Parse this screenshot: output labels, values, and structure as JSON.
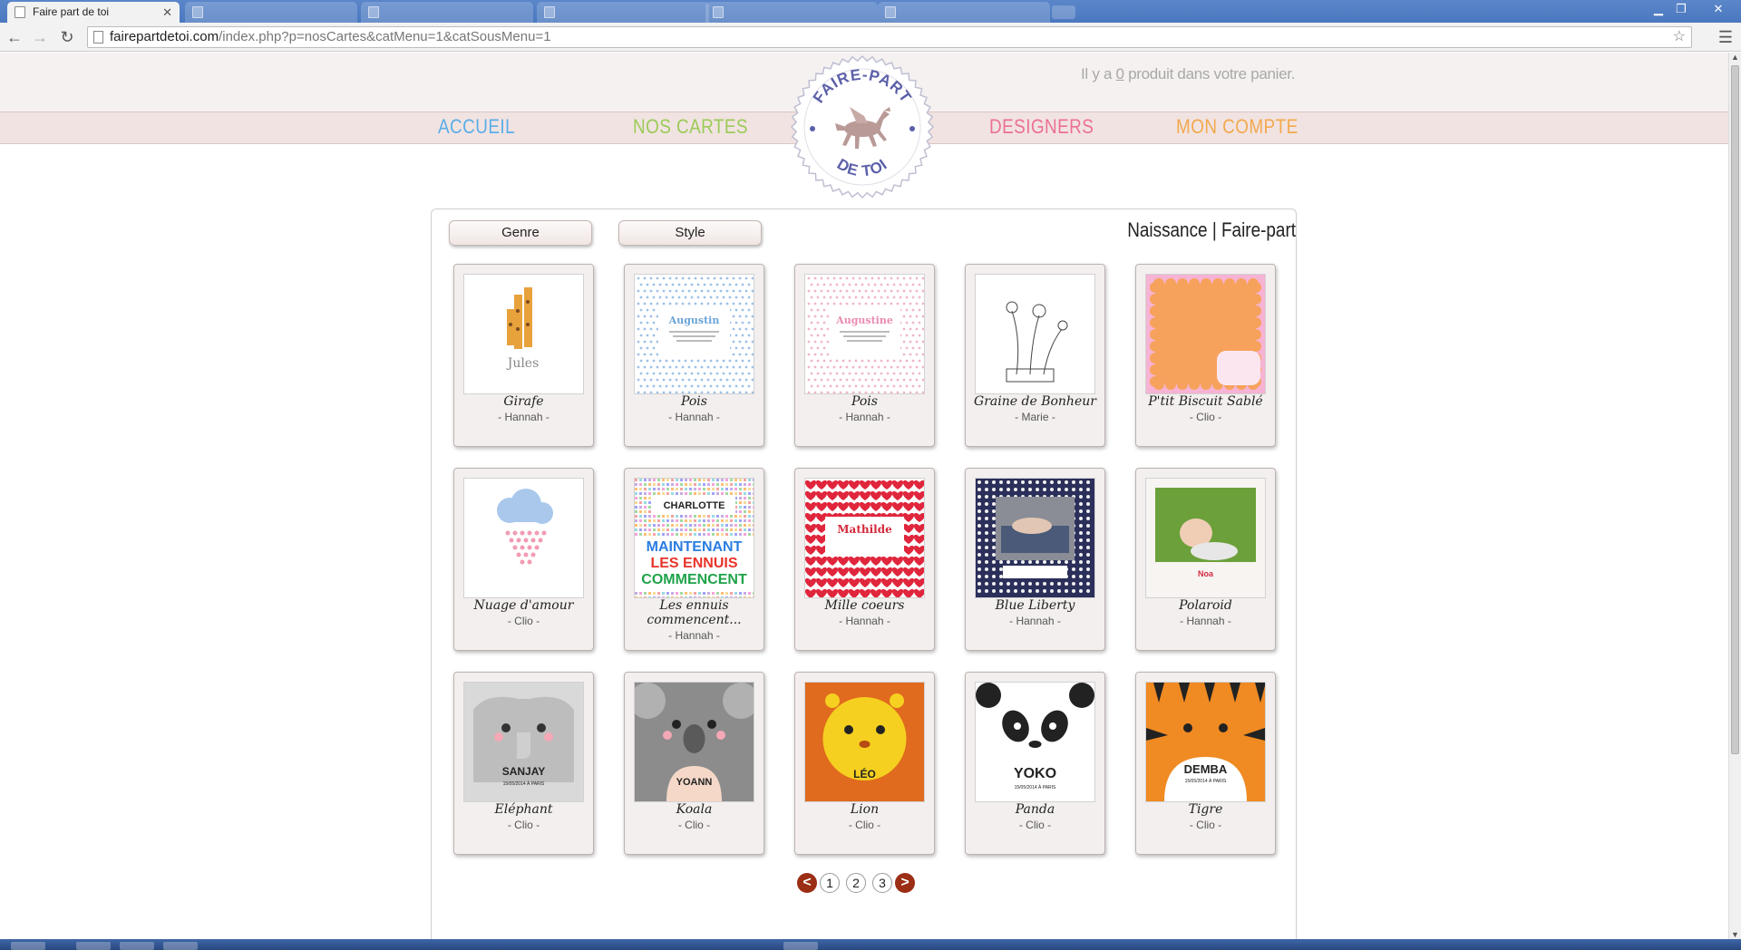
{
  "browser": {
    "active_tab_title": "Faire part de toi",
    "url_host": "fairepartdetoi.com",
    "url_path": "/index.php?p=nosCartes&catMenu=1&catSousMenu=1"
  },
  "header": {
    "cart_prefix": "Il y a ",
    "cart_count": "0",
    "cart_suffix": " produit dans votre panier.",
    "logo_top": "FAIRE-PART",
    "logo_bottom": "DE TOI"
  },
  "nav": [
    {
      "label": "ACCUEIL",
      "color": "#5aaee8"
    },
    {
      "label": "NOS CARTES",
      "color": "#9bcb58"
    },
    {
      "label": "DESIGNERS",
      "color": "#ec7094"
    },
    {
      "label": "MON COMPTE",
      "color": "#f2a94f"
    }
  ],
  "filters": {
    "genre": "Genre",
    "style": "Style"
  },
  "section_title": "Naissance | Faire-part",
  "cards": [
    {
      "name": "Girafe",
      "designer": "- Hannah -",
      "art": "girafe"
    },
    {
      "name": "Pois",
      "designer": "- Hannah -",
      "art": "pois-blue",
      "thumb_text": "Augustin"
    },
    {
      "name": "Pois",
      "designer": "- Hannah -",
      "art": "pois-pink",
      "thumb_text": "Augustine"
    },
    {
      "name": "Graine de Bonheur",
      "designer": "- Marie -",
      "art": "graine"
    },
    {
      "name": "P'tit Biscuit Sablé",
      "designer": "- Clio -",
      "art": "biscuit"
    },
    {
      "name": "Nuage d'amour",
      "designer": "- Clio -",
      "art": "nuage"
    },
    {
      "name": "Les ennuis commencent...",
      "designer": "- Hannah -",
      "art": "ennuis",
      "thumb_text": "CHARLOTTE",
      "thumb_lines": [
        "MAINTENANT",
        "LES ENNUIS",
        "COMMENCENT"
      ]
    },
    {
      "name": "Mille coeurs",
      "designer": "- Hannah -",
      "art": "coeurs",
      "thumb_text": "Mathilde"
    },
    {
      "name": "Blue Liberty",
      "designer": "- Hannah -",
      "art": "liberty"
    },
    {
      "name": "Polaroid",
      "designer": "- Hannah -",
      "art": "polaroid",
      "thumb_text": "Noa"
    },
    {
      "name": "Eléphant",
      "designer": "- Clio -",
      "art": "elephant",
      "thumb_text": "SANJAY",
      "thumb_sub": "15/05/2014 À PARIS"
    },
    {
      "name": "Koala",
      "designer": "- Clio -",
      "art": "koala",
      "thumb_text": "YOANN"
    },
    {
      "name": "Lion",
      "designer": "- Clio -",
      "art": "lion",
      "thumb_text": "LÉO"
    },
    {
      "name": "Panda",
      "designer": "- Clio -",
      "art": "panda",
      "thumb_text": "YOKO",
      "thumb_sub": "15/05/2014 À PARIS"
    },
    {
      "name": "Tigre",
      "designer": "- Clio -",
      "art": "tigre",
      "thumb_text": "DEMBA",
      "thumb_sub": "15/05/2014 À PARIS"
    }
  ],
  "pagination": {
    "prev": "<",
    "pages": [
      "1",
      "2",
      "3"
    ],
    "next": ">"
  }
}
